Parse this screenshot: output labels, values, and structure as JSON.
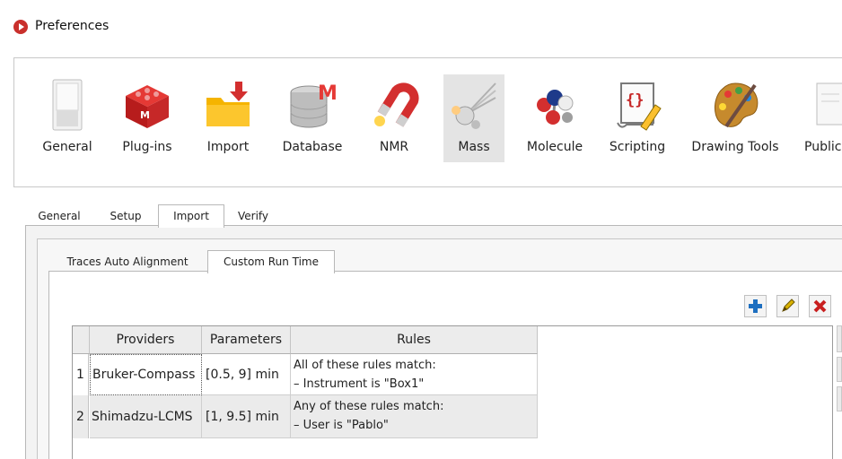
{
  "window": {
    "title": "Preferences"
  },
  "toolbar": {
    "items": [
      {
        "label": "General",
        "icon": "switch-icon"
      },
      {
        "label": "Plug-ins",
        "icon": "plugin-cube-icon"
      },
      {
        "label": "Import",
        "icon": "import-folder-icon"
      },
      {
        "label": "Database",
        "icon": "database-icon"
      },
      {
        "label": "NMR",
        "icon": "magnet-icon"
      },
      {
        "label": "Mass",
        "icon": "mass-spec-icon",
        "selected": true
      },
      {
        "label": "Molecule",
        "icon": "molecule-icon"
      },
      {
        "label": "Scripting",
        "icon": "script-scroll-icon"
      },
      {
        "label": "Drawing Tools",
        "icon": "palette-icon"
      },
      {
        "label": "Public",
        "icon": "document-icon"
      }
    ]
  },
  "tabs": {
    "items": [
      {
        "label": "General"
      },
      {
        "label": "Setup"
      },
      {
        "label": "Import",
        "active": true
      },
      {
        "label": "Verify"
      }
    ]
  },
  "subtabs": {
    "items": [
      {
        "label": "Traces Auto Alignment"
      },
      {
        "label": "Custom Run Time",
        "active": true
      }
    ]
  },
  "actions": {
    "add": "add-icon",
    "edit": "edit-pencil-icon",
    "delete": "delete-icon",
    "colors": {
      "add": "#1e6fc0",
      "edit": "#d9b200",
      "delete": "#c81e1e"
    }
  },
  "table": {
    "columns": [
      "Providers",
      "Parameters",
      "Rules"
    ],
    "rows": [
      {
        "num": "1",
        "provider": "Bruker-Compass",
        "parameters": "[0.5, 9] min",
        "rules": [
          "All of these rules match:",
          "– Instrument is \"Box1\""
        ]
      },
      {
        "num": "2",
        "provider": "Shimadzu-LCMS",
        "parameters": "[1, 9.5] min",
        "rules": [
          "Any of these rules match:",
          "– User is \"Pablo\""
        ]
      }
    ]
  }
}
